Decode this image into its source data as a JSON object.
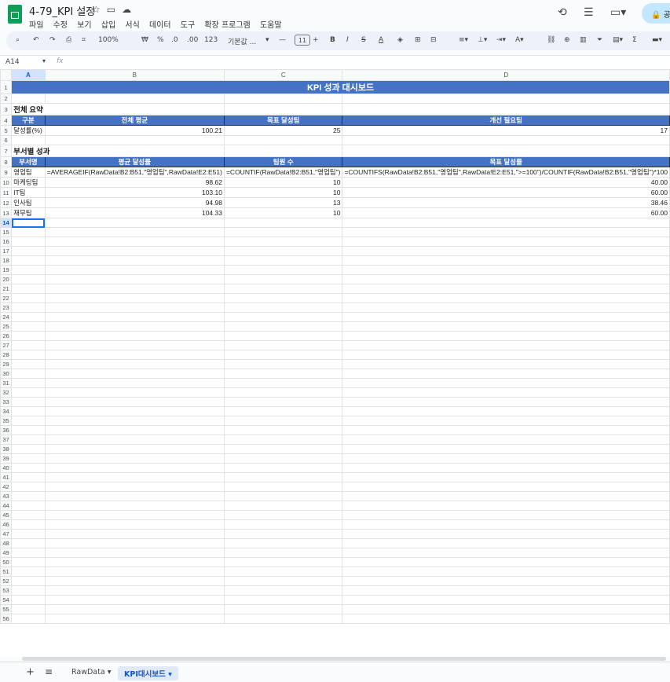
{
  "app": {
    "title": "4-79_KPI 설정",
    "menu": [
      "파일",
      "수정",
      "보기",
      "삽입",
      "서식",
      "데이터",
      "도구",
      "확장 프로그램",
      "도움말"
    ],
    "share_label": "공"
  },
  "toolbar": {
    "zoom": "100%",
    "currency": "₩",
    "percent": "%",
    "dec_less": ".0",
    "dec_more": ".00",
    "number_format": "123",
    "font_name": "기본값 ...",
    "font_size": "11"
  },
  "formula_bar": {
    "name_box": "A14",
    "fx": "fx",
    "content": ""
  },
  "columns": [
    "A",
    "B",
    "C",
    "D"
  ],
  "rows": {
    "1": [
      "KPI 성과 대시보드"
    ],
    "3": [
      "전체 요약"
    ],
    "4": [
      "구분",
      "전체 평균",
      "목표 달성팀",
      "개선 필요팀"
    ],
    "5": [
      "달성률(%)",
      "100.21",
      "25",
      "17"
    ],
    "7": [
      "부서별 성과"
    ],
    "8": [
      "부서명",
      "평균 달성률",
      "팀원 수",
      "목표 달성률"
    ],
    "9": [
      "영업팀",
      "=AVERAGEIF(RawData!B2:B51,\"영업팀\",RawData!E2:E51)",
      "=COUNTIF(RawData!B2:B51,\"영업팀\")",
      "=COUNTIFS(RawData!B2:B51,\"영업팀\",RawData!E2:E51,\">=100\")/COUNTIF(RawData!B2:B51,\"영업팀\")*100"
    ],
    "10": [
      "마케팅팀",
      "98.62",
      "10",
      "40.00"
    ],
    "11": [
      "IT팀",
      "103.10",
      "10",
      "60.00"
    ],
    "12": [
      "인사팀",
      "94.98",
      "13",
      "38.46"
    ],
    "13": [
      "재무팀",
      "104.33",
      "10",
      "60.00"
    ]
  },
  "row_count": 56,
  "selected_cell": "A14",
  "sheets": [
    {
      "label": "RawData",
      "active": false
    },
    {
      "label": "KPI대시보드",
      "active": true
    }
  ],
  "colors": {
    "header_fill": "#4472c4",
    "selection": "#1a73e8",
    "sheet_active": "#0b57d0"
  }
}
